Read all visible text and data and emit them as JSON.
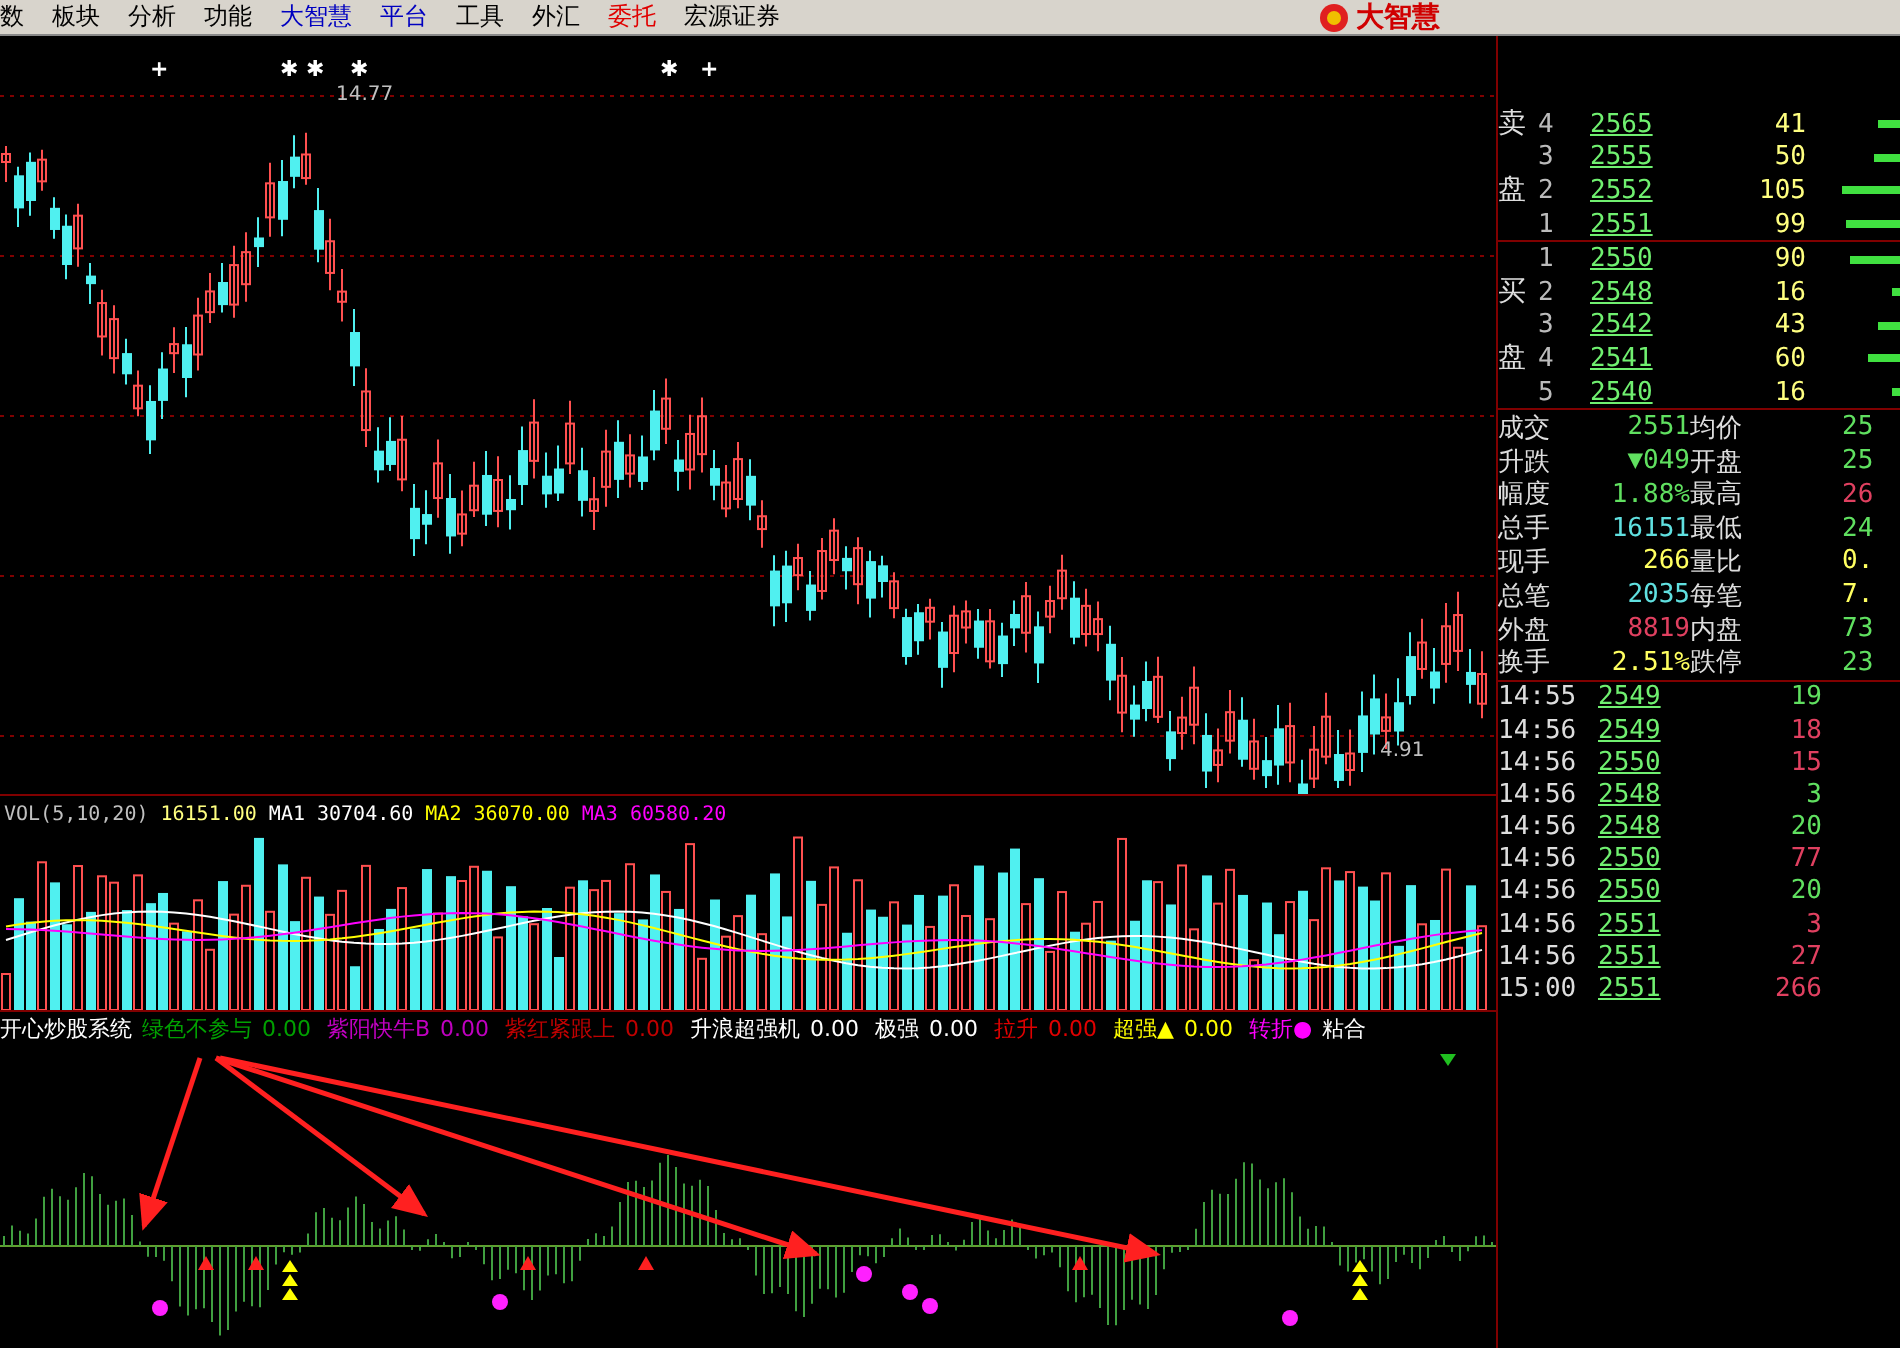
{
  "menu": [
    {
      "label": "数",
      "color": "#000000"
    },
    {
      "label": "板块",
      "color": "#000000"
    },
    {
      "label": "分析",
      "color": "#000000"
    },
    {
      "label": "功能",
      "color": "#000000"
    },
    {
      "label": "大智慧",
      "color": "#0000c0"
    },
    {
      "label": "平台",
      "color": "#0000c0"
    },
    {
      "label": "工具",
      "color": "#000000"
    },
    {
      "label": "外汇",
      "color": "#000000"
    },
    {
      "label": "委托",
      "color": "#e00000"
    },
    {
      "label": "宏源证券",
      "color": "#000000"
    }
  ],
  "logo": {
    "text": "大智慧"
  },
  "price_chart": {
    "markers": [
      "+",
      "✱",
      "✱",
      "✱",
      "✱",
      "+"
    ],
    "high_label": "14.77",
    "low_label": "4.91"
  },
  "volume": {
    "legend": [
      {
        "text": "VOL(5,10,20)",
        "color": "#c0c0c0"
      },
      {
        "text": "16151.00",
        "color": "#ffff80"
      },
      {
        "text": "MA1",
        "color": "#ffffff"
      },
      {
        "text": "30704.60",
        "color": "#ffffff"
      },
      {
        "text": "MA2",
        "color": "#ffff00"
      },
      {
        "text": "36070.00",
        "color": "#ffff00"
      },
      {
        "text": "MA3",
        "color": "#ff00ff"
      },
      {
        "text": "60580.20",
        "color": "#ff00ff"
      }
    ]
  },
  "indicator": {
    "title": "开心炒股系统",
    "items": [
      {
        "label": "绿色不参与",
        "value": "0.00",
        "color": "#00a000"
      },
      {
        "label": "紫阳快牛B",
        "value": "0.00",
        "color": "#c000c0"
      },
      {
        "label": "紫红紧跟上",
        "value": "0.00",
        "color": "#c00000"
      },
      {
        "label": "升浪超强机",
        "value": "0.00",
        "color": "#ffffff"
      },
      {
        "label": "极强",
        "value": "0.00",
        "color": "#ffffff"
      },
      {
        "label": "拉升",
        "value": "0.00",
        "color": "#e00000"
      },
      {
        "label": "超强▲",
        "value": "0.00",
        "color": "#ffff00"
      },
      {
        "label": "转折●",
        "color": "#ff00ff"
      },
      {
        "label": "粘合",
        "color": "#ffffff"
      }
    ]
  },
  "order_book": {
    "sell": [
      {
        "side": "卖",
        "level": "4",
        "price": "2565",
        "volume": "41"
      },
      {
        "level": "3",
        "price": "2555",
        "volume": "50"
      },
      {
        "side": "盘",
        "level": "2",
        "price": "2552",
        "volume": "105"
      },
      {
        "level": "1",
        "price": "2551",
        "volume": "99"
      }
    ],
    "buy": [
      {
        "level": "1",
        "price": "2550",
        "volume": "90"
      },
      {
        "side": "买",
        "level": "2",
        "price": "2548",
        "volume": "16"
      },
      {
        "level": "3",
        "price": "2542",
        "volume": "43"
      },
      {
        "side": "盘",
        "level": "4",
        "price": "2541",
        "volume": "60"
      },
      {
        "level": "5",
        "price": "2540",
        "volume": "16"
      }
    ]
  },
  "stats": [
    {
      "left": {
        "label": "成交",
        "value": "2551",
        "color": "#60e060"
      },
      "right": {
        "label": "均价",
        "value": "25",
        "color": "#60e060"
      }
    },
    {
      "left": {
        "label": "升跌",
        "value": "▼049",
        "color": "#60e060"
      },
      "right": {
        "label": "开盘",
        "value": "25",
        "color": "#60e060"
      }
    },
    {
      "left": {
        "label": "幅度",
        "value": "1.88%",
        "color": "#60e060"
      },
      "right": {
        "label": "最高",
        "value": "26",
        "color": "#e04060"
      }
    },
    {
      "left": {
        "label": "总手",
        "value": "16151",
        "color": "#60e0e0"
      },
      "right": {
        "label": "最低",
        "value": "24",
        "color": "#60e060"
      }
    },
    {
      "left": {
        "label": "现手",
        "value": "266",
        "color": "#ffff60"
      },
      "right": {
        "label": "量比",
        "value": "0.",
        "color": "#ffff60"
      }
    },
    {
      "left": {
        "label": "总笔",
        "value": "2035",
        "color": "#60e0e0"
      },
      "right": {
        "label": "每笔",
        "value": "7.",
        "color": "#ffff60"
      }
    },
    {
      "left": {
        "label": "外盘",
        "value": "8819",
        "color": "#e04060"
      },
      "right": {
        "label": "内盘",
        "value": "73",
        "color": "#60e060"
      }
    },
    {
      "left": {
        "label": "换手",
        "value": "2.51%",
        "color": "#ffff60"
      },
      "right": {
        "label": "跌停",
        "value": "23",
        "color": "#60e060"
      }
    }
  ],
  "ticks": [
    {
      "time": "14:55",
      "price": "2549",
      "volume": "19",
      "color": "#60e060"
    },
    {
      "time": "14:56",
      "price": "2549",
      "volume": "18",
      "color": "#e04060"
    },
    {
      "time": "14:56",
      "price": "2550",
      "volume": "15",
      "color": "#e04060"
    },
    {
      "time": "14:56",
      "price": "2548",
      "volume": "3",
      "color": "#60e060"
    },
    {
      "time": "14:56",
      "price": "2548",
      "volume": "20",
      "color": "#60e060"
    },
    {
      "time": "14:56",
      "price": "2550",
      "volume": "77",
      "color": "#e04060"
    },
    {
      "time": "14:56",
      "price": "2550",
      "volume": "20",
      "color": "#60e060"
    },
    {
      "time": "14:56",
      "price": "2551",
      "volume": "3",
      "color": "#e04060"
    },
    {
      "time": "14:56",
      "price": "2551",
      "volume": "27",
      "color": "#e04060"
    },
    {
      "time": "15:00",
      "price": "2551",
      "volume": "266",
      "color": "#e04060"
    }
  ]
}
